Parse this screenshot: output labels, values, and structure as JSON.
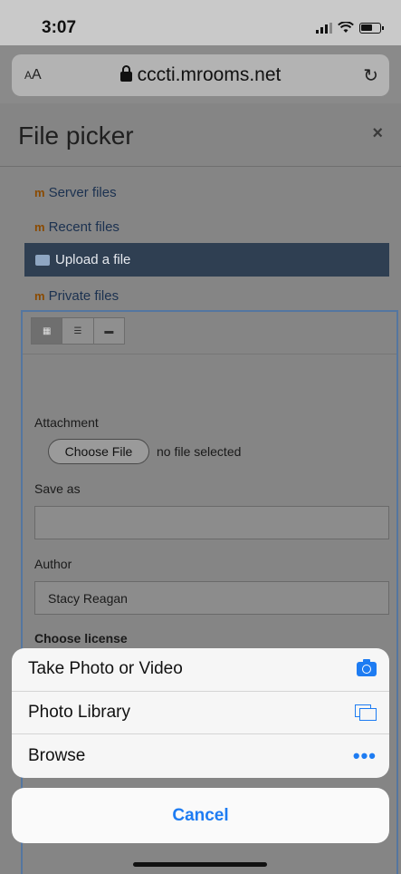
{
  "status": {
    "time": "3:07"
  },
  "browser": {
    "aa_small": "A",
    "aa_large": "A",
    "url": "cccti.mrooms.net",
    "reload": "↻"
  },
  "dialog": {
    "title": "File picker",
    "close": "×"
  },
  "repositories": [
    {
      "label": "Server files",
      "icon": "moodle-icon"
    },
    {
      "label": "Recent files",
      "icon": "moodle-icon"
    },
    {
      "label": "Upload a file",
      "icon": "upload-icon",
      "active": true
    },
    {
      "label": "Private files",
      "icon": "moodle-icon"
    }
  ],
  "form": {
    "attachment_label": "Attachment",
    "choose_file": "Choose File",
    "no_file": "no file selected",
    "save_as_label": "Save as",
    "save_as_value": "",
    "author_label": "Author",
    "author_value": "Stacy Reagan",
    "license_label": "Choose license"
  },
  "action_sheet": {
    "items": [
      {
        "label": "Take Photo or Video",
        "icon": "camera-icon"
      },
      {
        "label": "Photo Library",
        "icon": "photo-library-icon"
      },
      {
        "label": "Browse",
        "icon": "more-icon",
        "glyph": "•••"
      }
    ],
    "cancel": "Cancel"
  },
  "colors": {
    "accent": "#1e7cf2",
    "active_repo": "#2f3f52"
  }
}
